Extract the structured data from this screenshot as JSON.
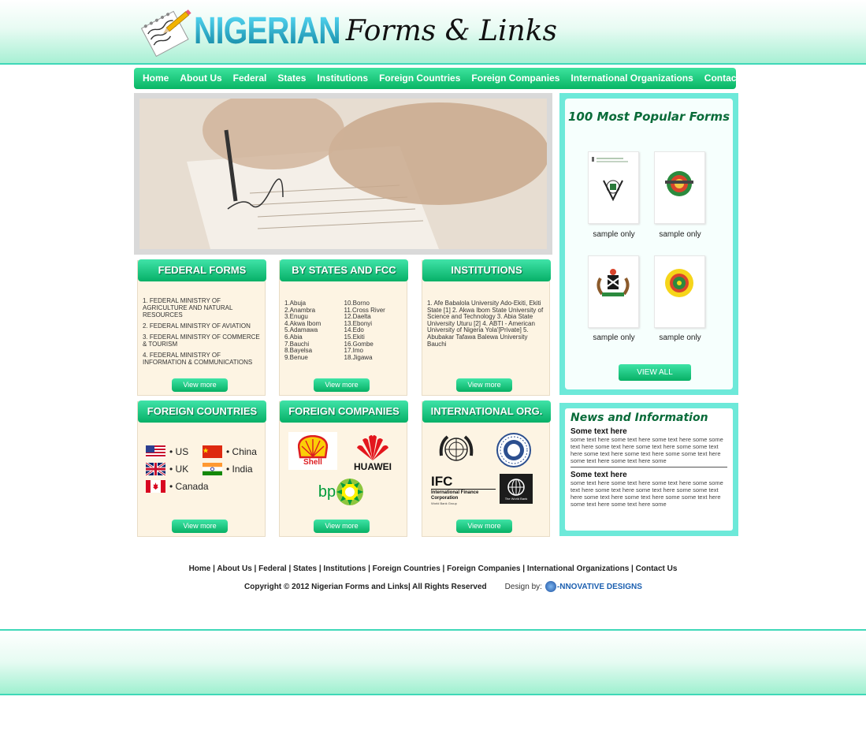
{
  "header": {
    "logo_main": "NIGERIAN",
    "logo_script": "Forms & Links"
  },
  "nav": {
    "items": [
      "Home",
      "About Us",
      "Federal",
      "States",
      "Institutions",
      "Foreign Countries",
      "Foreign Companies",
      "International Organizations",
      "Contact Us"
    ]
  },
  "sections": {
    "federal": {
      "title": "FEDERAL FORMS",
      "items": [
        "1. FEDERAL MINISTRY OF AGRICULTURE AND NATURAL RESOURCES",
        "2. FEDERAL MINISTRY OF AVIATION",
        "3. FEDERAL MINISTRY OF COMMERCE & TOURISM",
        "4. FEDERAL MINISTRY OF INFORMATION & COMMUNICATIONS"
      ],
      "button": "View more"
    },
    "states": {
      "title": "BY STATES AND FCC",
      "col1": [
        "1.Abuja",
        "2.Anambra",
        "3.Enugu",
        "4.Akwa Ibom",
        "5.Adamawa",
        "6.Abia",
        "7.Bauchi",
        "8.Bayelsa",
        "9.Benue"
      ],
      "col2": [
        "10.Borno",
        "11.Cross River",
        "12.Daelta",
        "13.Ebonyi",
        "14.Edo",
        "15.Ekiti",
        "16.Gombe",
        "17.Imo",
        "18.Jigawa"
      ],
      "button": "View more"
    },
    "institutions": {
      "title": "INSTITUTIONS",
      "text": "1. Afe Babalola University Ado-Ekiti, Ekiti State [1] 2. Akwa Ibom State University of Science and Technology 3. Abia State University Uturu [2] 4. ABTI - American University of Nigeria Yola'[Private] 5. Abubakar Tafawa Balewa University Bauchi",
      "button": "View more"
    },
    "foreign_countries": {
      "title": "FOREIGN COUNTRIES",
      "countries": [
        "• US",
        "• China",
        "• UK",
        "• India",
        "• Canada"
      ],
      "button": "View more"
    },
    "foreign_companies": {
      "title": "FOREIGN COMPANIES",
      "logos": [
        "Shell",
        "HUAWEI",
        "bp"
      ],
      "button": "View more"
    },
    "intl_org": {
      "title": "INTERNATIONAL ORG.",
      "logo_texts": [
        "IFC",
        "International Finance Corporation",
        "World Bank Group",
        "The World Bank"
      ],
      "button": "View more"
    }
  },
  "popular": {
    "title": "100 Most Popular Forms",
    "captions": [
      "sample only",
      "sample only",
      "sample only",
      "sample only"
    ],
    "button": "VIEW ALL"
  },
  "news": {
    "title": "News and Information",
    "items": [
      {
        "head": "Some text here",
        "body": "some text here some text here some text here some some text here some text here some text here some some text here some text here some text here some some text here some text here some text here some"
      },
      {
        "head": "Some text here",
        "body": "some text here some text here some text here some some text here some text here some text here some some text here some text here some text here some some text here some text here some text here some"
      }
    ]
  },
  "footer": {
    "links": "Home | About Us | Federal | States | Institutions | Foreign Countries | Foreign Companies | International Organizations | Contact Us",
    "copyright": "Copyright © 2012 Nigerian Forms and Links| All Rights Reserved",
    "design_label": "Design by:",
    "design_brand": "-NNOVATIVE DESIGNS"
  },
  "colors": {
    "nav_green": "#08b564",
    "accent_teal": "#6de9d9",
    "title_green": "#0a6b39"
  }
}
